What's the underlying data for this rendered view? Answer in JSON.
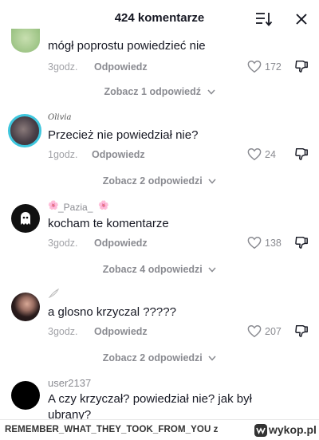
{
  "header": {
    "title": "424 komentarze"
  },
  "comments": [
    {
      "username": "",
      "text": "mógł poprostu powiedzieć nie",
      "time": "3godz.",
      "reply_label": "Odpowiedz",
      "likes": "172",
      "view_replies": "Zobacz 1 odpowiedź"
    },
    {
      "username": "Olivia",
      "text": "Przecież nie powiedział nie?",
      "time": "1godz.",
      "reply_label": "Odpowiedz",
      "likes": "24",
      "view_replies": "Zobacz 2 odpowiedzi"
    },
    {
      "username": "_Pazia_",
      "text": "kocham te komentarze",
      "time": "3godz.",
      "reply_label": "Odpowiedz",
      "likes": "138",
      "view_replies": "Zobacz 4 odpowiedzi"
    },
    {
      "username": "",
      "text": "a glosno krzyczal ?????",
      "time": "3godz.",
      "reply_label": "Odpowiedz",
      "likes": "207",
      "view_replies": "Zobacz 2 odpowiedzi"
    },
    {
      "username": "user2137",
      "text": "A czy krzyczał? powiedział nie? jak był ubrany?"
    }
  ],
  "footer": {
    "caption": "REMEMBER_WHAT_THEY_TOOK_FROM_YOU z",
    "logo_text": "wykop.pl"
  },
  "colors": {
    "accent_ring": "#3ec6dd",
    "muted": "#8a8b91",
    "text": "#161823"
  }
}
